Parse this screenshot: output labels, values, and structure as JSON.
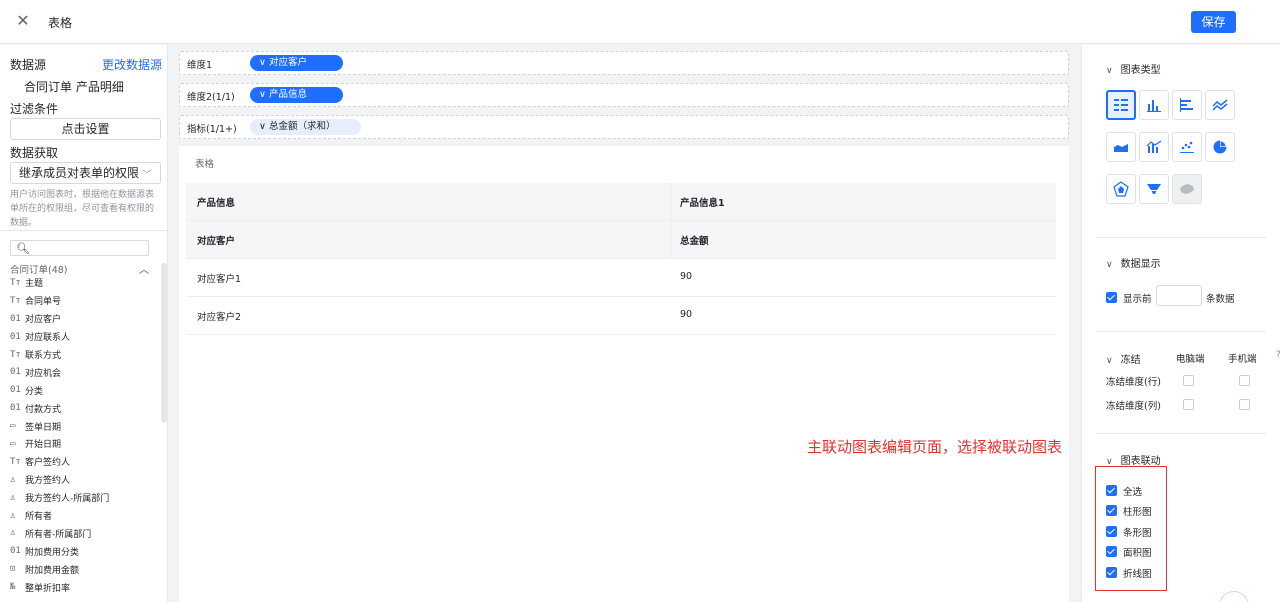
{
  "header": {
    "title": "表格",
    "save_label": "保存"
  },
  "left": {
    "datasource_label": "数据源",
    "change_datasource": "更改数据源",
    "datasource_name": "合同订单  产品明细",
    "filter_label": "过滤条件",
    "filter_button": "点击设置",
    "fetch_label": "数据获取",
    "fetch_select": "继承成员对表单的权限",
    "fetch_hint": "用户访问图表时，根据他在数据源表单所在的权限组，尽可查看有权限的数据。",
    "search_placeholder": "",
    "group_label": "合同订单(48)",
    "fields": [
      {
        "icon": "Tт",
        "label": "主题"
      },
      {
        "icon": "Tт",
        "label": "合同单号"
      },
      {
        "icon": "01",
        "label": "对应客户"
      },
      {
        "icon": "01",
        "label": "对应联系人"
      },
      {
        "icon": "Tт",
        "label": "联系方式"
      },
      {
        "icon": "01",
        "label": "对应机会"
      },
      {
        "icon": "01",
        "label": "分类"
      },
      {
        "icon": "01",
        "label": "付款方式"
      },
      {
        "icon": "▭",
        "label": "签单日期"
      },
      {
        "icon": "▭",
        "label": "开始日期"
      },
      {
        "icon": "Tт",
        "label": "客户签约人"
      },
      {
        "icon": "♙",
        "label": "我方签约人"
      },
      {
        "icon": "♙",
        "label": "我方签约人-所属部门"
      },
      {
        "icon": "♙",
        "label": "所有者"
      },
      {
        "icon": "♙",
        "label": "所有者-所属部门"
      },
      {
        "icon": "01",
        "label": "附加费用分类"
      },
      {
        "icon": "⊡",
        "label": "附加费用金额"
      },
      {
        "icon": "№",
        "label": "整单折扣率"
      }
    ]
  },
  "center": {
    "dim1_label": "维度1",
    "dim1_pill": "对应客户",
    "dim2_label": "维度2(1/1)",
    "dim2_pill": "产品信息",
    "metric_label": "指标(1/1+)",
    "metric_pill": "总金额（求和）",
    "canvas_title": "表格",
    "table": {
      "rows": [
        {
          "c1": "产品信息",
          "c2": "产品信息1"
        },
        {
          "c1": "对应客户",
          "c2": "总金额"
        },
        {
          "c1": "对应客户1",
          "c2": "90"
        },
        {
          "c1": "对应客户2",
          "c2": "90"
        }
      ]
    }
  },
  "annotation": "主联动图表编辑页面，选择被联动图表",
  "right": {
    "chart_type_title": "图表类型",
    "data_display_title": "数据显示",
    "show_first_label": "显示前",
    "show_first_value": "",
    "rows_suffix": "条数据",
    "freeze_title": "冻结",
    "pc_label": "电脑端",
    "mobile_label": "手机端",
    "freeze_row_label": "冻结维度(行)",
    "freeze_col_label": "冻结维度(列)",
    "linkage_title": "图表联动",
    "linkage_items": [
      "全选",
      "柱形图",
      "条形图",
      "面积图",
      "折线图"
    ]
  },
  "colors": {
    "accent": "#1e6fff",
    "annotation": "#e0342e"
  }
}
